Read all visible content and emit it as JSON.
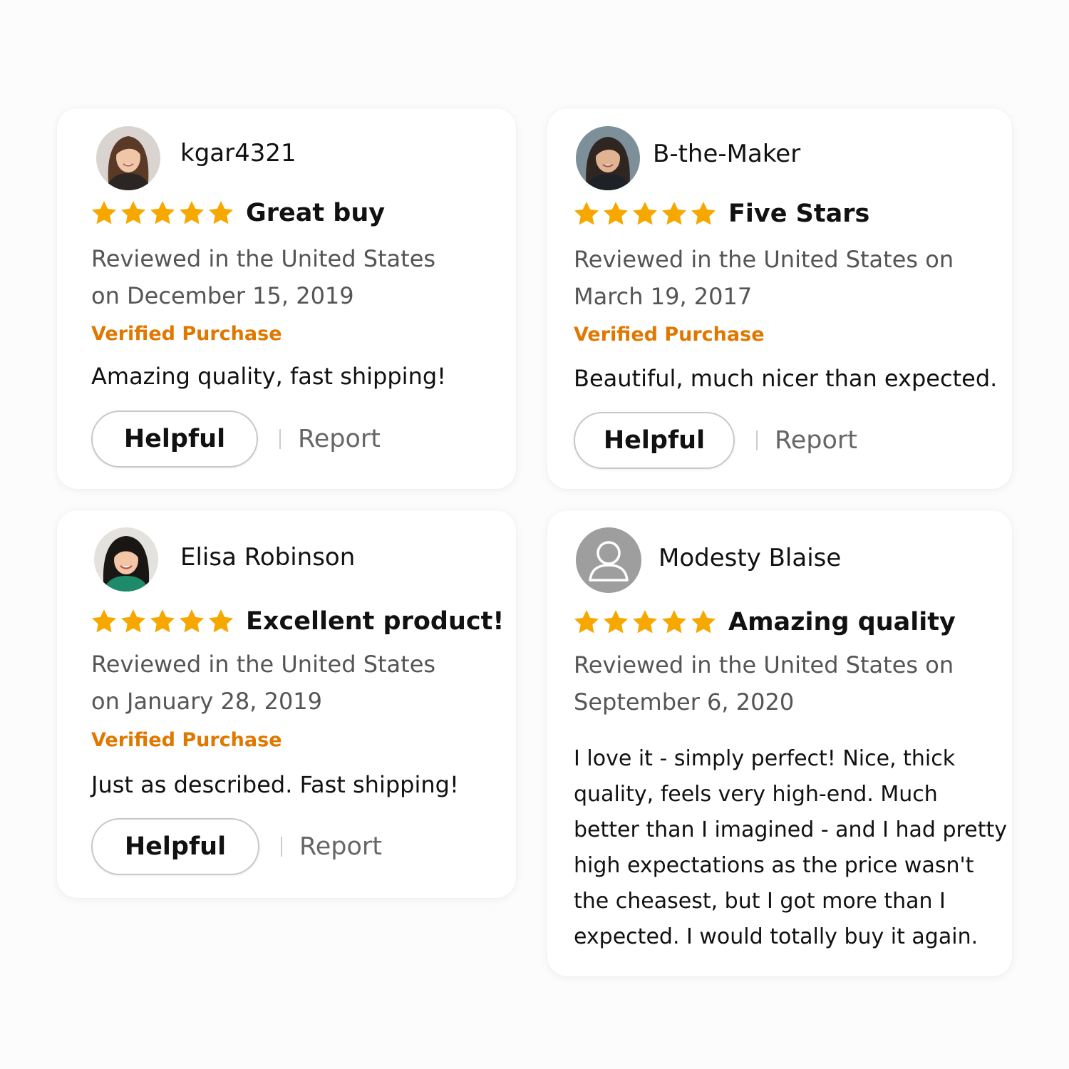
{
  "colors": {
    "star": "#f6a800",
    "verified": "#e07800",
    "meta_text": "#555555",
    "button_border": "#c8c8c8"
  },
  "reviews": [
    {
      "reviewer": "kgar4321",
      "avatar": "avatar-photo-icon",
      "rating": 5,
      "title": "Great buy",
      "meta": "Reviewed in the United States on December 15, 2019",
      "verified": "Verified Purchase",
      "body": "Amazing quality, fast shipping!",
      "helpful_label": "Helpful",
      "report_label": "Report"
    },
    {
      "reviewer": "B-the-Maker",
      "avatar": "avatar-photo-icon",
      "rating": 5,
      "title": "Five Stars",
      "meta": "Reviewed in the United States on March 19, 2017",
      "verified": "Verified Purchase",
      "body": "Beautiful, much nicer than expected.",
      "helpful_label": "Helpful",
      "report_label": "Report"
    },
    {
      "reviewer": "Elisa Robinson",
      "avatar": "avatar-photo-icon",
      "rating": 5,
      "title": "Excellent product!",
      "meta": "Reviewed in the United States on January 28, 2019",
      "verified": "Verified Purchase",
      "body": "Just as described. Fast shipping!",
      "helpful_label": "Helpful",
      "report_label": "Report"
    },
    {
      "reviewer": "Modesty Blaise",
      "avatar": "default-user-icon",
      "rating": 5,
      "title": "Amazing quality",
      "meta": "Reviewed in the United States on September 6, 2020",
      "body": "I love it - simply perfect! Nice, thick quality, feels very high-end. Much better than I imagined - and I had pretty high expectations as the price wasn't the cheasest, but I got more than I expected. I would totally buy it again."
    }
  ]
}
